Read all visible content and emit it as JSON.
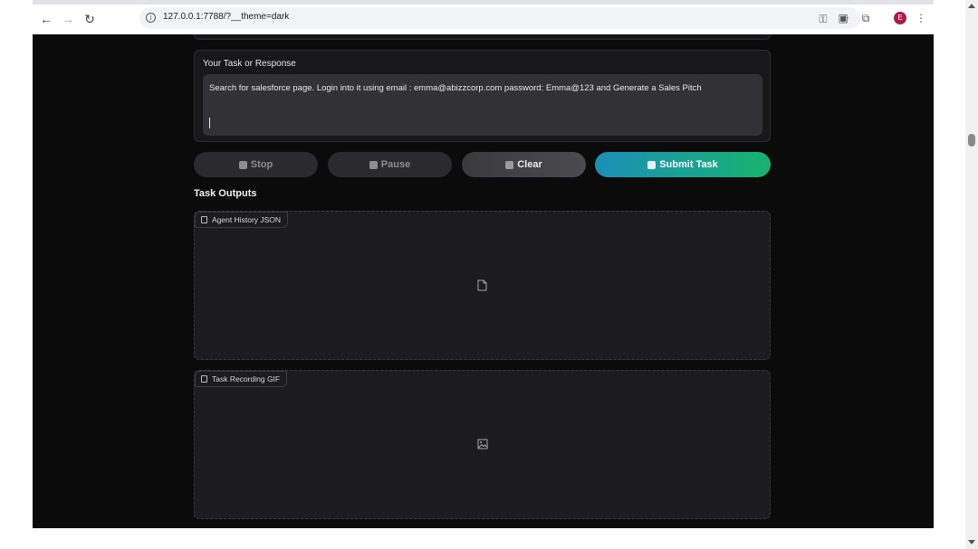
{
  "browser": {
    "url": "127.0.0.1:7788/?__theme=dark",
    "profile_initial": "E"
  },
  "task": {
    "label": "Your Task or Response",
    "value": "Search for salesforce page. Login into it using email : emma@abizzcorp.com password: Emma@123 and Generate a Sales Pitch"
  },
  "buttons": {
    "stop": "Stop",
    "pause": "Pause",
    "clear": "Clear",
    "submit": "Submit Task"
  },
  "outputs": {
    "title": "Task Outputs",
    "json_label": "Agent History JSON",
    "gif_label": "Task Recording GIF"
  },
  "icons": {
    "back": "arrow-left-icon",
    "forward": "arrow-right-icon",
    "reload": "reload-icon",
    "site_info": "info-icon",
    "password": "key-icon",
    "bookmark": "star-icon",
    "extension": "puzzle-icon",
    "menu": "kebab-menu-icon",
    "file": "file-icon",
    "image": "image-icon"
  },
  "colors": {
    "page_background": "#0b0b0b",
    "submit_gradient_start": "#1b8fb8",
    "submit_gradient_end": "#18b36f",
    "avatar": "#b3174a"
  }
}
